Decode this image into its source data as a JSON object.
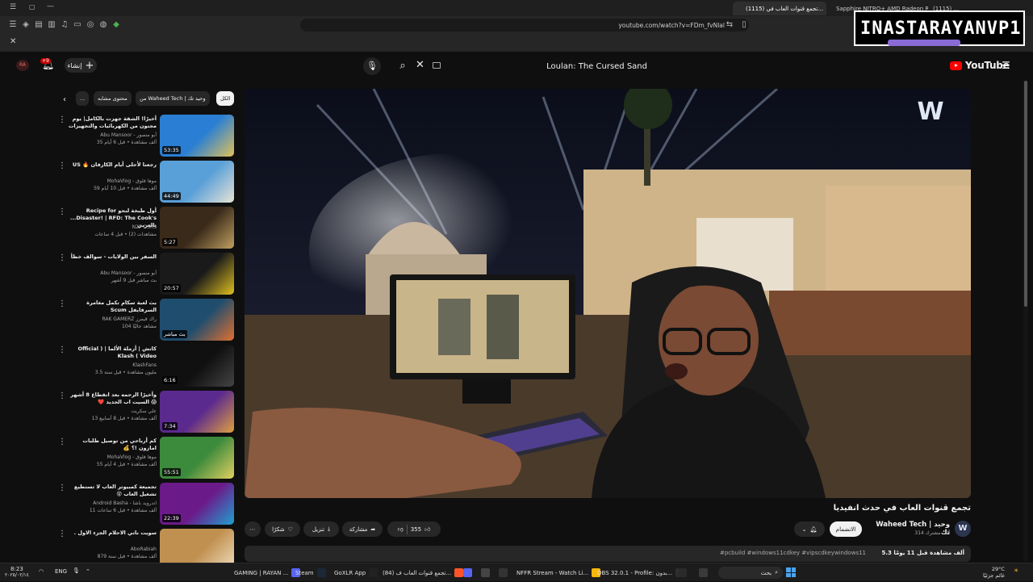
{
  "browser": {
    "tabs": [
      {
        "label": "(1115) تجمع قنوات العاب في...",
        "active": true
      },
      {
        "label": "Sapphire NITRO+ AMD Radeon RX",
        "active": false
      },
      {
        "label": "(1115) ...",
        "active": false
      }
    ],
    "url": "youtube.com/watch?v=FDm_fvNlal"
  },
  "watermark": {
    "left": "INASTA",
    "right": "RAYANVP1"
  },
  "youtube": {
    "logo_text": "YouTube",
    "search_value": "Loulan: The Cursed Sand",
    "create_label": "إنشاء",
    "notif_count": "+9",
    "chips": [
      {
        "label": "الكل",
        "active": true
      },
      {
        "label": "من Waheed Tech | وحيد تك",
        "active": false
      },
      {
        "label": "محتوى مشابه",
        "active": false
      },
      {
        "label": "...",
        "active": false
      }
    ],
    "recommendations": [
      {
        "title": "أخيرًا! الشقة جهزت بالكامل| يوم مجنون من الكهربائيات والتجهيزات",
        "channel": "Abu Mansoor - أبو منصور",
        "meta": "35 ألف مشاهدة • قبل 6 أيام",
        "duration": "53:35",
        "color1": "#2a7fd4",
        "color2": "#e0c15b"
      },
      {
        "title": "رجعنا لأحلى أيام الكارفان 🔥 US",
        "channel": "MohaVlog - موها فلوق",
        "meta": "59 ألف مشاهدة • قبل 10 أيام",
        "duration": "44:49",
        "color1": "#5aa0d8",
        "color2": "#e8e3d6"
      },
      {
        "title": "أول طبخة لنحو Recipe for Disaster! | RFD: The Cook's... بالعربي",
        "channel": "N2P OSRS",
        "meta": "مشاهدات (2) • قبل 4 ساعات",
        "duration": "5:27",
        "color1": "#3a2a1a",
        "color2": "#c0a060"
      },
      {
        "title": "السفر بين الولايات - سوالف خطأ",
        "channel": "Abu Mansoor - أبو منصور",
        "meta": "بث مباشر قبل 9 أشهر",
        "duration": "20:57",
        "color1": "#1a1a1a",
        "color2": "#e0c020"
      },
      {
        "title": "بث لعبة سكام تكمل مغامرة السرفايفل Scum",
        "channel": "RAK GAMERZ راك قيمرز",
        "meta": "104 مشاهد حاليًا",
        "duration": "بث مباشر",
        "color1": "#1f4d6e",
        "color2": "#e07030"
      },
      {
        "title": "كاتش | أرملة الألما | ( Official Video ) Klash",
        "channel": "KlashFans",
        "meta": "3.5 مليون مشاهدة • قبل سنة",
        "duration": "6:16",
        "color1": "#101010",
        "color2": "#444"
      },
      {
        "title": "وأخيرًا الرحمه بعد انقطاع 8 أشهر 😱 السيت اب الجديد ❤️",
        "channel": "علي سكريت",
        "meta": "13 ألف مشاهدة • قبل 8 أسابيع",
        "duration": "7:34",
        "color1": "#5b2a8e",
        "color2": "#e0a040"
      },
      {
        "title": "كم أرباحي من توصيل طلبات امازون !؟ 💰",
        "channel": "MohaVlog - موها فلوق",
        "meta": "55 ألف مشاهدة • قبل 4 أيام",
        "duration": "55:51",
        "color1": "#3c8a3c",
        "color2": "#e0d060"
      },
      {
        "title": "تجميعة كمبيوتر العاب لا تستطيع تشغيل العاب 😵",
        "channel": "Android Basha - اندرويد باشا",
        "meta": "11 ألف مشاهدة • قبل 6 ساعات",
        "duration": "22:39",
        "color1": "#6b1a8a",
        "color2": "#20a0d0"
      },
      {
        "title": "سويت ناتي الاحلام الجزء الاول .",
        "channel": "AboRabiah",
        "meta": "879 ألف مشاهدة • قبل سنة",
        "duration": "",
        "color1": "#c09050",
        "color2": "#f0e0c0"
      }
    ],
    "video": {
      "title": "تجمع قنوات العاب في حدث انفيديا",
      "channel": "Waheed Tech | وحيد تك",
      "subs": "314 ألف مشترك",
      "join_label": "الانضمام",
      "likes": "355",
      "share_label": "مشاركة",
      "download_label": "تنزيل",
      "thanks_label": "شكرًا",
      "desc_stats": "5.3 ألف مشاهدة قبل 11 يومًا",
      "desc_tags": "#pcbuild #windows11cdkey #vipscdkeywindows11"
    }
  },
  "taskbar": {
    "time": "8:23",
    "date": "٢٠٢٥/٠٢/١٤",
    "weather": "29°C",
    "weather_sub": "غائم جزئيًا",
    "lang": "ENG",
    "search_label": "بحث",
    "items": [
      {
        "label": "GAMING | RAYAN ...",
        "color": "#5865f2"
      },
      {
        "label": "Steam",
        "color": "#1b2838"
      },
      {
        "label": "GoXLR App",
        "color": "#222"
      },
      {
        "label": "(84) تجمع قنوات العاب ف...",
        "color": "#fb542b"
      },
      {
        "label": "NFFR Stream - Watch Li...",
        "color": "#f6b80c"
      },
      {
        "label": "OBS 32.0.1 - Profile: بدون...",
        "color": "#302e31"
      }
    ]
  }
}
